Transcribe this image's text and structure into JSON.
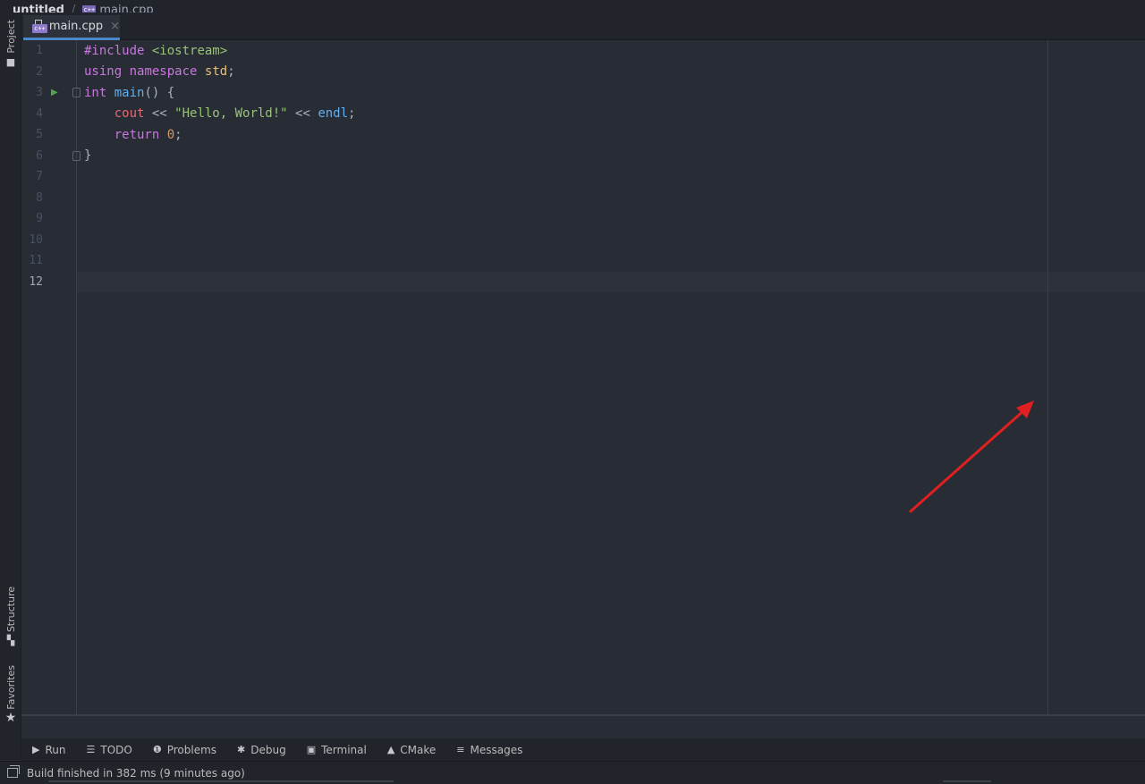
{
  "breadcrumb": {
    "project": "untitled",
    "file": "main.cpp"
  },
  "left_tools": {
    "project_label": "Project",
    "structure_label": "Structure",
    "favorites_label": "Favorites"
  },
  "editor_tab": {
    "label": "main.cpp",
    "close": "×"
  },
  "editor": {
    "line_numbers": [
      "1",
      "2",
      "3",
      "4",
      "5",
      "6",
      "7",
      "8",
      "9",
      "10",
      "11",
      "12"
    ],
    "current_line": "12",
    "code": {
      "l1_kw": "#include",
      "l1_rest": " <iostream>",
      "l2_kw1": "using",
      "l2_kw2": "namespace",
      "l2_id": "std",
      "l2_end": ";",
      "l3_kw": "int",
      "l3_fn": "main",
      "l3_rest": "() {",
      "l4_indent": "    ",
      "l4_cout": "cout",
      "l4_op1": " << ",
      "l4_str": "\"Hello, World!\"",
      "l4_op2": " << ",
      "l4_endl": "endl",
      "l4_end": ";",
      "l5_indent": "    ",
      "l5_kw": "return",
      "l5_num": "0",
      "l5_end": ";",
      "l6": "}"
    }
  },
  "toolwindows": {
    "run": "Run",
    "todo": "TODO",
    "problems": "Problems",
    "debug": "Debug",
    "terminal": "Terminal",
    "cmake": "CMake",
    "messages": "Messages"
  },
  "status": {
    "message": "Build finished in 382 ms (9 minutes ago)"
  },
  "colors": {
    "annotation_arrow": "#e02020",
    "tab_accent": "#4a88c7",
    "background": "#282c34"
  }
}
